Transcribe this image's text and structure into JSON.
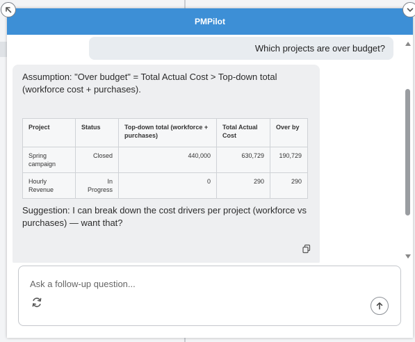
{
  "app": {
    "title": "PMPilot"
  },
  "chat": {
    "user_message": "Which projects are over budget?",
    "bot": {
      "assumption": "Assumption: \"Over budget\" = Total Actual Cost > Top-down total (workforce cost + purchases).",
      "table": {
        "headers": [
          "Project",
          "Status",
          "Top-down total (workforce + purchases)",
          "Total Actual Cost",
          "Over by"
        ],
        "rows": [
          [
            "Spring campaign",
            "Closed",
            "440,000",
            "630,729",
            "190,729"
          ],
          [
            "Hourly Revenue",
            "In Progress",
            "0",
            "290",
            "290"
          ]
        ]
      },
      "suggestion": "Suggestion: I can break down the cost drivers per project (workforce vs purchases) — want that?"
    }
  },
  "composer": {
    "placeholder": "Ask a follow-up question..."
  },
  "colors": {
    "titlebar": "#3d8fd6",
    "bubble": "#eeeff1"
  },
  "icons": {
    "expand": "arrow-up-left-icon",
    "collapse": "chevron-down-icon",
    "copy": "copy-icon",
    "refresh": "refresh-icon",
    "send": "arrow-up-icon"
  }
}
